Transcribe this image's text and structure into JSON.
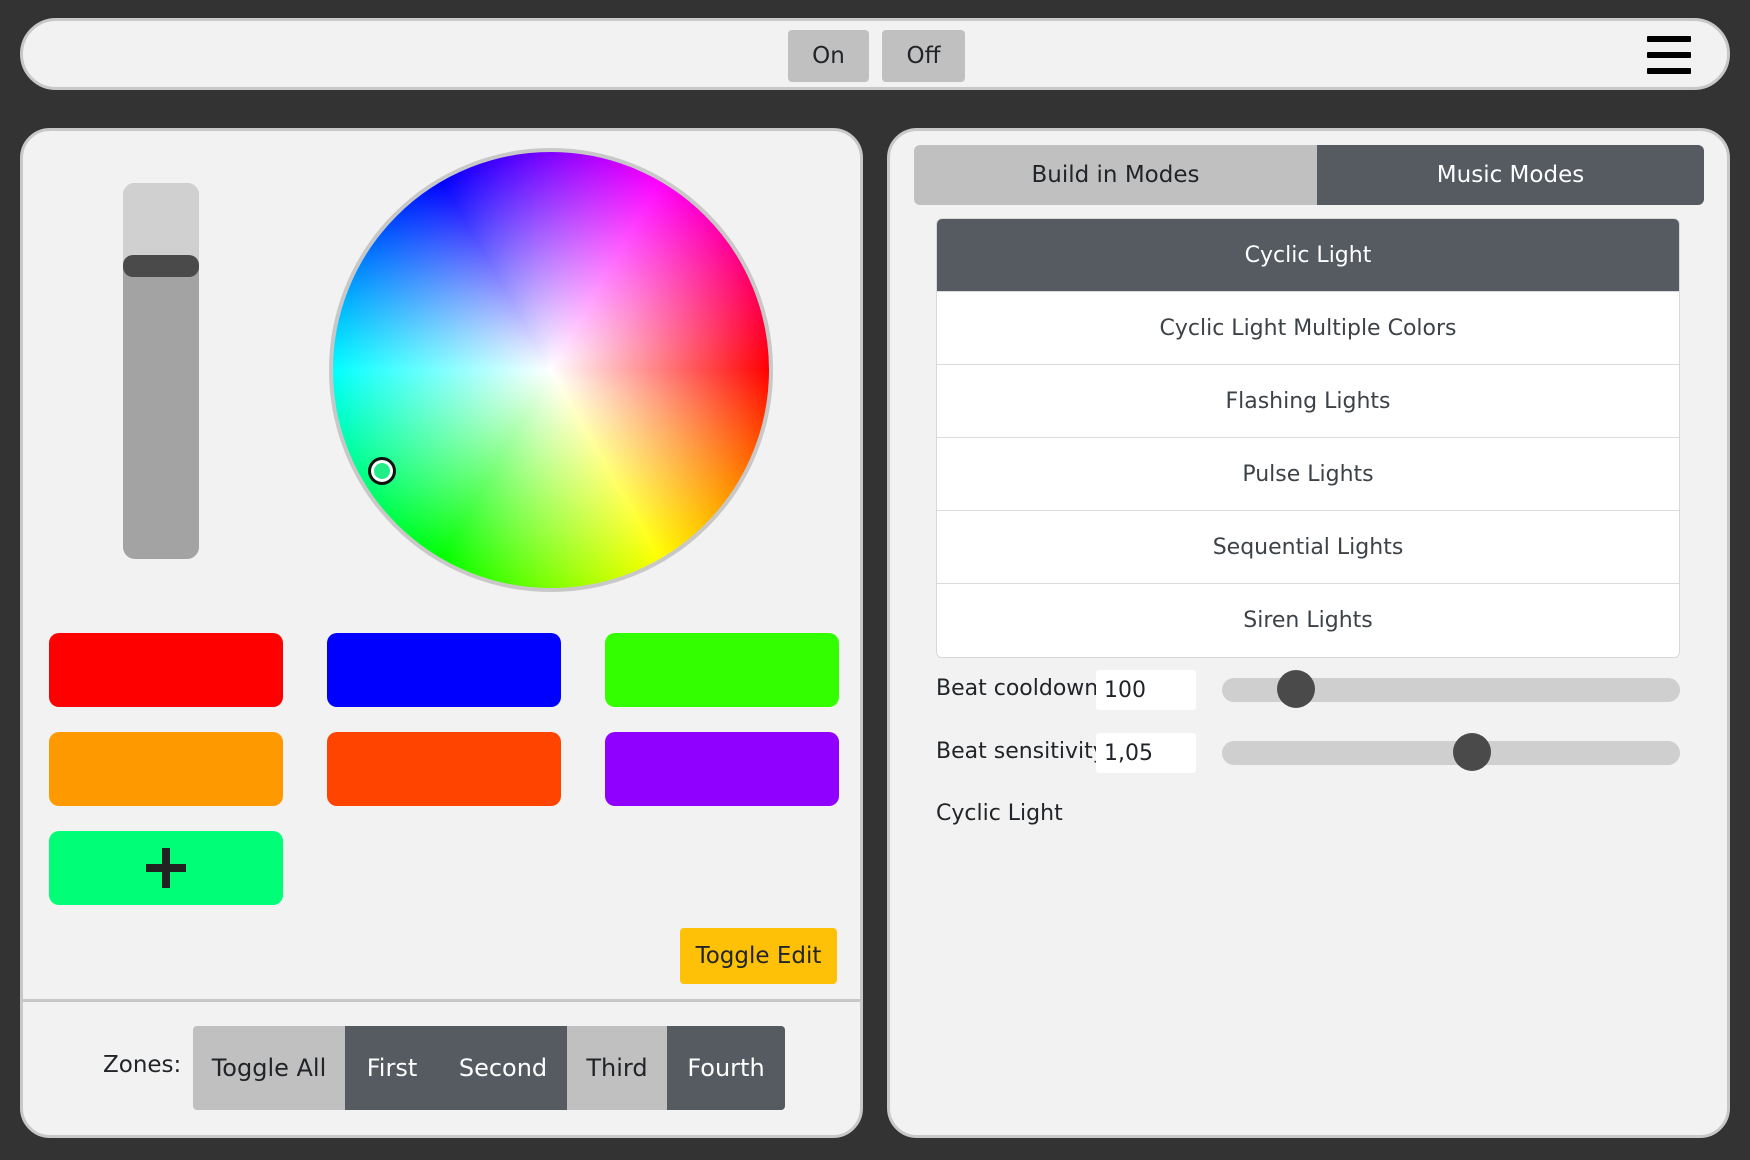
{
  "topbar": {
    "on_label": "On",
    "off_label": "Off",
    "menu_icon": "hamburger-menu-icon"
  },
  "color_panel": {
    "brightness_level": 0.78,
    "selected_color": "#22ee88",
    "swatches": [
      {
        "color": "#ff0000"
      },
      {
        "color": "#0000ff"
      },
      {
        "color": "#33ff00"
      },
      {
        "color": "#ff9900"
      },
      {
        "color": "#ff4400"
      },
      {
        "color": "#9000ff"
      }
    ],
    "add_swatch_color": "#00ff77",
    "add_icon": "plus-icon",
    "toggle_edit_label": "Toggle Edit",
    "zones_label": "Zones:",
    "zones": [
      {
        "label": "Toggle All",
        "state": "inactive"
      },
      {
        "label": "First",
        "state": "active"
      },
      {
        "label": "Second",
        "state": "active"
      },
      {
        "label": "Third",
        "state": "inactive"
      },
      {
        "label": "Fourth",
        "state": "active"
      }
    ]
  },
  "modes_panel": {
    "tabs": [
      {
        "label": "Build in Modes",
        "active": false
      },
      {
        "label": "Music Modes",
        "active": true
      }
    ],
    "modes": [
      {
        "label": "Cyclic Light",
        "active": true
      },
      {
        "label": "Cyclic Light Multiple Colors",
        "active": false
      },
      {
        "label": "Flashing Lights",
        "active": false
      },
      {
        "label": "Pulse Lights",
        "active": false
      },
      {
        "label": "Sequential Lights",
        "active": false
      },
      {
        "label": "Siren Lights",
        "active": false
      }
    ],
    "beat_cooldown": {
      "label": "Beat cooldown:",
      "value": "100",
      "slider_fraction": 0.13
    },
    "beat_sensitivity": {
      "label": "Beat sensitivity:",
      "value": "1,05",
      "slider_fraction": 0.55
    },
    "current_mode_text": "Cyclic Light"
  }
}
